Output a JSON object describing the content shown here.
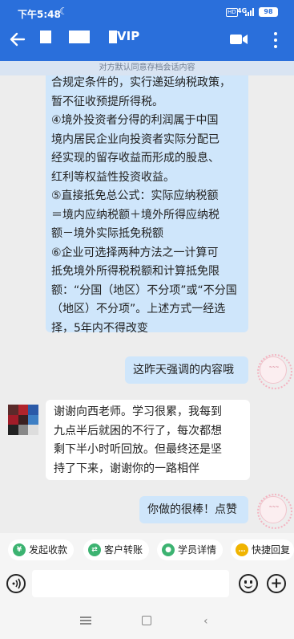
{
  "status_bar": {
    "time": "下午5:48",
    "network": "4G",
    "hd": "HD",
    "battery": "98"
  },
  "header": {
    "title": "VIP"
  },
  "notice": "对方默认同意存档会话内容",
  "messages": [
    {
      "side": "right",
      "lines": [
        "合规定条件的，实行递延纳税政策，",
        "暂不征收预提所得税。",
        "④境外投资者分得的利润属于中国",
        "境内居民企业向投资者实际分配已",
        "经实现的留存收益而形成的股息、",
        "红利等权益性投资收益。",
        "⑤直接抵免总公式：实际应纳税额",
        "＝境内应纳税额＋境外所得应纳税",
        "额－境外实际抵免税额",
        "⑥企业可选择两种方法之一计算可",
        "抵免境外所得税税额和计算抵免限",
        "额：“分国（地区）不分项”或“不分国",
        "（地区）不分项”。上述方式一经选",
        "择，5年内不得改变"
      ]
    },
    {
      "side": "right",
      "lines": [
        "这昨天强调的内容哦"
      ]
    },
    {
      "side": "left",
      "lines": [
        "谢谢向西老师。学习很累，我每到",
        "九点半后就困的不行了，每次都想",
        "剩下半小时听回放。但最终还是坚",
        "持了下来，谢谢你的一路相伴"
      ]
    },
    {
      "side": "right",
      "lines": [
        "你做的很棒！点赞"
      ]
    }
  ],
  "quick_actions": [
    {
      "label": "发起收款",
      "icon": "yen-icon",
      "color": "#3cb371"
    },
    {
      "label": "客户转账",
      "icon": "transfer-icon",
      "color": "#3cb371"
    },
    {
      "label": "学员详情",
      "icon": "user-icon",
      "color": "#3cb371"
    },
    {
      "label": "快捷回复",
      "icon": "chat-icon",
      "color": "#f0b400"
    }
  ],
  "colors": {
    "header": "#2a6fdb",
    "outgoing_bubble": "#cfe6fb",
    "incoming_bubble": "#ffffff",
    "background": "#ededed"
  }
}
